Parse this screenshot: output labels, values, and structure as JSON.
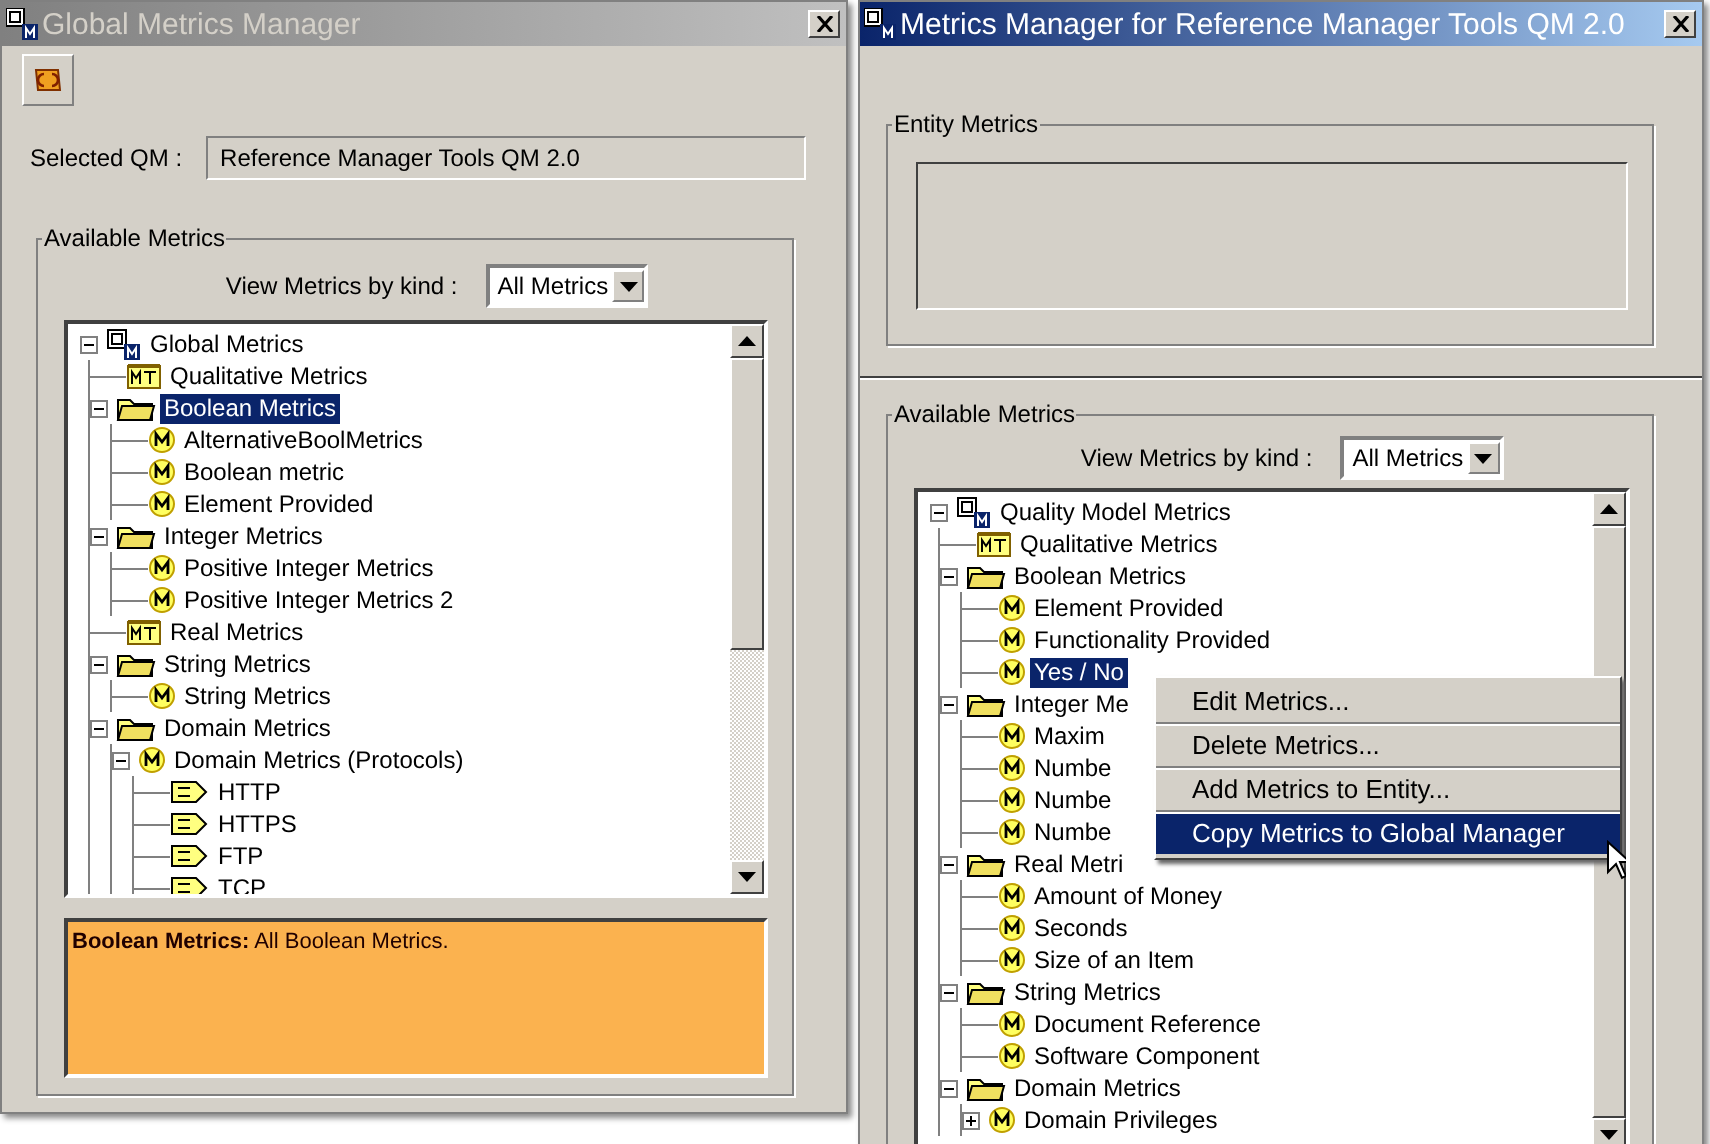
{
  "left_window": {
    "title": "Global Metrics Manager",
    "active": false,
    "selected_qm_label": "Selected QM :",
    "selected_qm": "Reference Manager Tools QM 2.0",
    "group_title": "Available Metrics",
    "view_label": "View Metrics by kind :",
    "view_value": "All Metrics",
    "tree": [
      {
        "label": "Global Metrics",
        "kind": "root",
        "selected": false,
        "expanded": true,
        "children": [
          {
            "label": "Qualitative Metrics",
            "kind": "mt",
            "selected": false
          },
          {
            "label": "Boolean Metrics",
            "kind": "folder",
            "selected": true,
            "expanded": true,
            "children": [
              {
                "label": "AlternativeBoolMetrics",
                "kind": "m",
                "selected": false
              },
              {
                "label": "Boolean metric",
                "kind": "m",
                "selected": false
              },
              {
                "label": "Element Provided",
                "kind": "m",
                "selected": false
              }
            ]
          },
          {
            "label": "Integer Metrics",
            "kind": "folder",
            "selected": false,
            "expanded": true,
            "children": [
              {
                "label": "Positive Integer Metrics",
                "kind": "m",
                "selected": false
              },
              {
                "label": "Positive Integer Metrics 2",
                "kind": "m",
                "selected": false
              }
            ]
          },
          {
            "label": "Real Metrics",
            "kind": "mt",
            "selected": false
          },
          {
            "label": "String Metrics",
            "kind": "folder",
            "selected": false,
            "expanded": true,
            "children": [
              {
                "label": "String Metrics",
                "kind": "m",
                "selected": false
              }
            ]
          },
          {
            "label": "Domain Metrics",
            "kind": "folder",
            "selected": false,
            "expanded": true,
            "children": [
              {
                "label": "Domain Metrics (Protocols)",
                "kind": "m",
                "selected": false,
                "expanded": true,
                "children": [
                  {
                    "label": "HTTP",
                    "kind": "de",
                    "selected": false
                  },
                  {
                    "label": "HTTPS",
                    "kind": "de",
                    "selected": false
                  },
                  {
                    "label": "FTP",
                    "kind": "de",
                    "selected": false
                  },
                  {
                    "label": "TCP",
                    "kind": "de",
                    "selected": false
                  }
                ]
              }
            ]
          }
        ]
      }
    ],
    "description": "**Boolean Metrics:** All Boolean Metrics."
  },
  "right_window": {
    "title": "Metrics Manager for Reference Manager Tools QM 2.0",
    "active": true,
    "entity_group_title": "Entity Metrics",
    "group_title": "Available Metrics",
    "view_label": "View Metrics by kind :",
    "view_value": "All Metrics",
    "tree": [
      {
        "label": "Quality Model Metrics",
        "kind": "root",
        "selected": false,
        "expanded": true,
        "children": [
          {
            "label": "Qualitative Metrics",
            "kind": "mt",
            "selected": false
          },
          {
            "label": "Boolean Metrics",
            "kind": "folder",
            "selected": false,
            "expanded": true,
            "children": [
              {
                "label": "Element Provided",
                "kind": "m",
                "selected": false
              },
              {
                "label": "Functionality Provided",
                "kind": "m",
                "selected": false
              },
              {
                "label": "Yes / No",
                "kind": "m",
                "selected": true
              }
            ]
          },
          {
            "label": "Integer Me",
            "kind": "folder",
            "selected": false,
            "expanded": true,
            "children": [
              {
                "label": "Maxim",
                "kind": "m",
                "selected": false
              },
              {
                "label": "Numbe",
                "kind": "m",
                "selected": false
              },
              {
                "label": "Numbe",
                "kind": "m",
                "selected": false
              },
              {
                "label": "Numbe",
                "kind": "m",
                "selected": false
              }
            ]
          },
          {
            "label": "Real Metri",
            "kind": "folder",
            "selected": false,
            "expanded": true,
            "children": [
              {
                "label": "Amount of Money",
                "kind": "m",
                "selected": false
              },
              {
                "label": "Seconds",
                "kind": "m",
                "selected": false
              },
              {
                "label": "Size of an Item",
                "kind": "m",
                "selected": false
              }
            ]
          },
          {
            "label": "String Metrics",
            "kind": "folder",
            "selected": false,
            "expanded": true,
            "children": [
              {
                "label": "Document Reference",
                "kind": "m",
                "selected": false
              },
              {
                "label": "Software Component",
                "kind": "m",
                "selected": false
              }
            ]
          },
          {
            "label": "Domain Metrics",
            "kind": "folder",
            "selected": false,
            "expanded": true,
            "children": [
              {
                "label": "Domain Privileges",
                "kind": "m",
                "selected": false,
                "expanded": false
              }
            ]
          }
        ]
      }
    ],
    "context_menu": [
      {
        "label": "Edit Metrics...",
        "selected": false
      },
      {
        "label": "Delete Metrics...",
        "selected": false
      },
      {
        "label": "Add Metrics to Entity...",
        "selected": false
      },
      {
        "label": "Copy Metrics to Global Manager",
        "selected": true
      }
    ]
  }
}
